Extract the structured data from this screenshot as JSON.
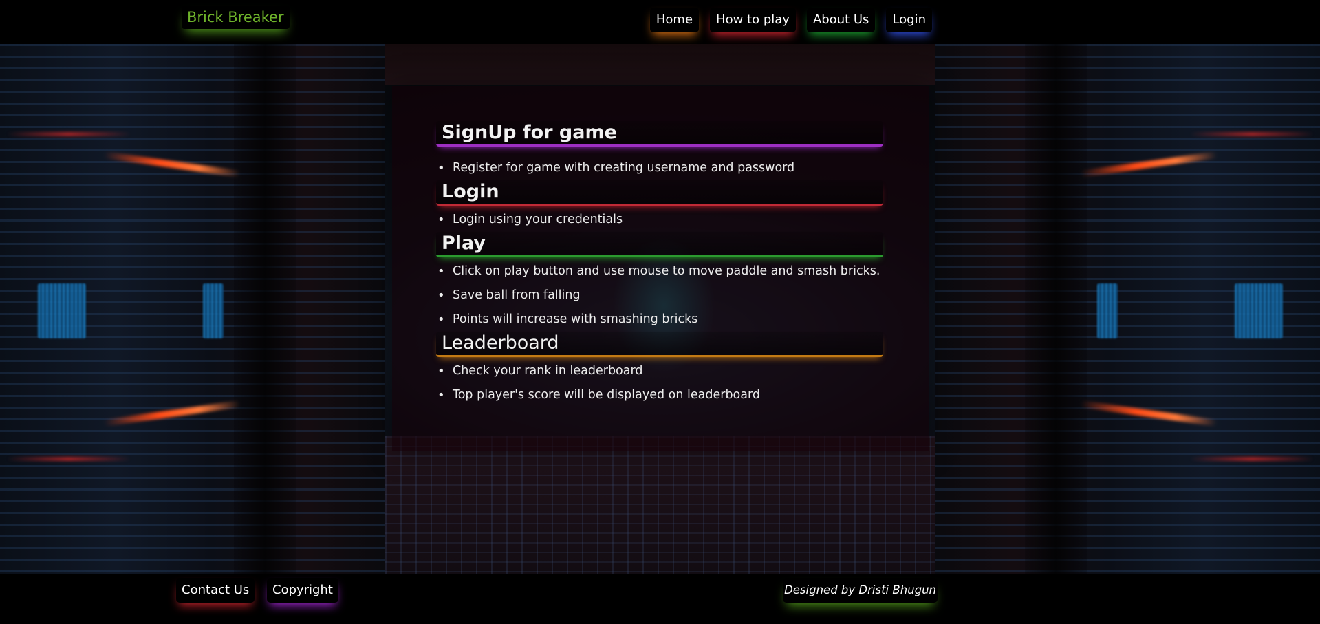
{
  "header": {
    "brand": "Brick Breaker",
    "nav": [
      {
        "label": "Home"
      },
      {
        "label": "How to play"
      },
      {
        "label": "About Us"
      },
      {
        "label": "Login"
      }
    ]
  },
  "sections": [
    {
      "title": "SignUp for game",
      "items": [
        "Register for game with creating username and password"
      ]
    },
    {
      "title": "Login",
      "items": [
        "Login using your credentials"
      ]
    },
    {
      "title": "Play",
      "items": [
        "Click on play button and use mouse to move paddle and smash bricks.",
        "Save ball from falling",
        "Points will increase with smashing bricks"
      ]
    },
    {
      "title": "Leaderboard",
      "items": [
        "Check your rank in leaderboard",
        "Top player's score will be displayed on leaderboard"
      ]
    }
  ],
  "footer": {
    "contact_label": "Contact Us",
    "copyright_label": "Copyright",
    "designed_by": "Designed by Dristi Bhugun"
  },
  "colors": {
    "brand": "#6fb32b",
    "accent_purple": "#9d2fc2",
    "accent_red": "#c02a36",
    "accent_green": "#2b9a2f",
    "accent_orange": "#c27a14",
    "accent_blue": "#3250e6"
  }
}
